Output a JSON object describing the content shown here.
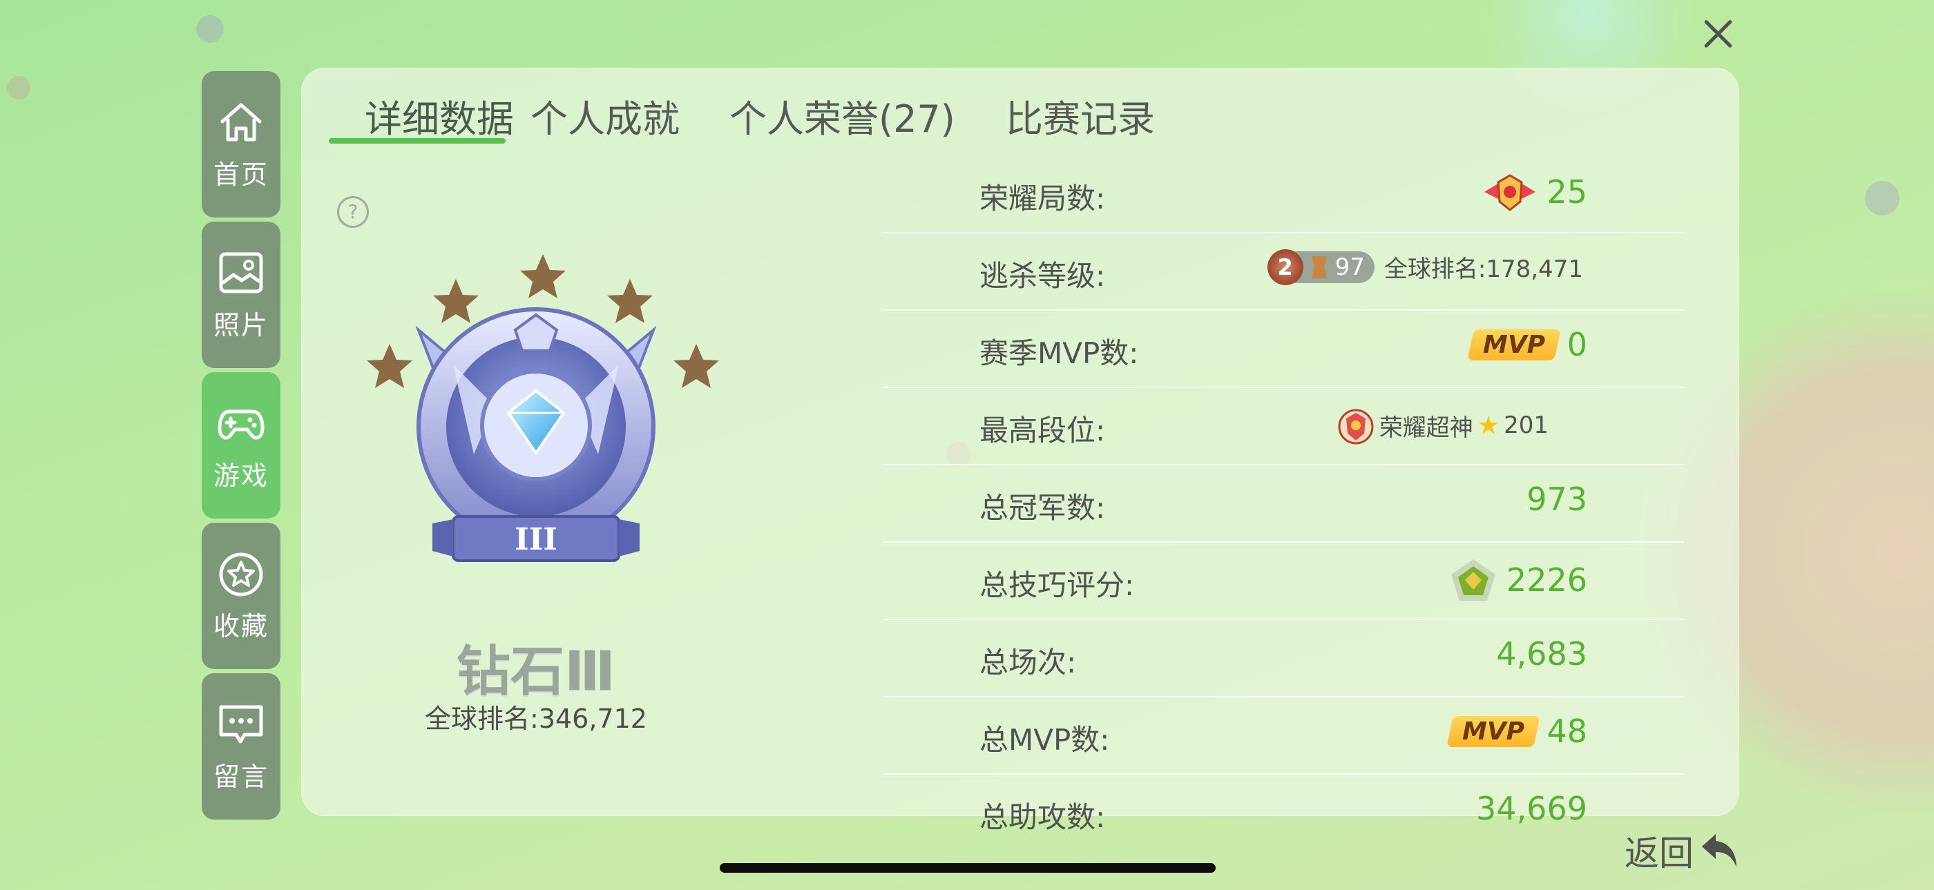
{
  "nav": {
    "items": [
      {
        "label": "首页",
        "icon": "home-icon"
      },
      {
        "label": "照片",
        "icon": "photo-icon"
      },
      {
        "label": "游戏",
        "icon": "gamepad-icon",
        "active": true
      },
      {
        "label": "收藏",
        "icon": "star-icon"
      },
      {
        "label": "留言",
        "icon": "message-icon"
      }
    ]
  },
  "tabs": [
    "详细数据",
    "个人成就",
    "个人荣誉(27)",
    "比赛记录"
  ],
  "active_tab": "详细数据",
  "rank": {
    "name": "钻石Ⅲ",
    "global_label": "全球排名:",
    "global_value": "346,712",
    "star_count": 5,
    "tier_roman": "III"
  },
  "stats": [
    {
      "label": "荣耀局数:",
      "value": "25",
      "icon": "glory-emblem-icon"
    },
    {
      "label": "逃杀等级:",
      "level_badge": "2",
      "level_value": "97",
      "rank_label": "全球排名:",
      "rank_value": "178,471"
    },
    {
      "label": "赛季MVP数:",
      "mvp_tag": "MVP",
      "value": "0"
    },
    {
      "label": "最高段位:",
      "rank_name": "荣耀超神",
      "stars": "201"
    },
    {
      "label": "总冠军数:",
      "value": "973"
    },
    {
      "label": "总技巧评分:",
      "value": "2226",
      "icon": "skill-pentagon-icon"
    },
    {
      "label": "总场次:",
      "value": "4,683"
    },
    {
      "label": "总MVP数:",
      "mvp_tag": "MVP",
      "value": "48"
    },
    {
      "label": "总助攻数:",
      "value": "34,669"
    }
  ],
  "back_label": "返回",
  "colors": {
    "accent": "#5bc04f",
    "value_green": "#55b331",
    "sidebar": "#7d9878",
    "sidebar_active": "#6cc96c"
  }
}
